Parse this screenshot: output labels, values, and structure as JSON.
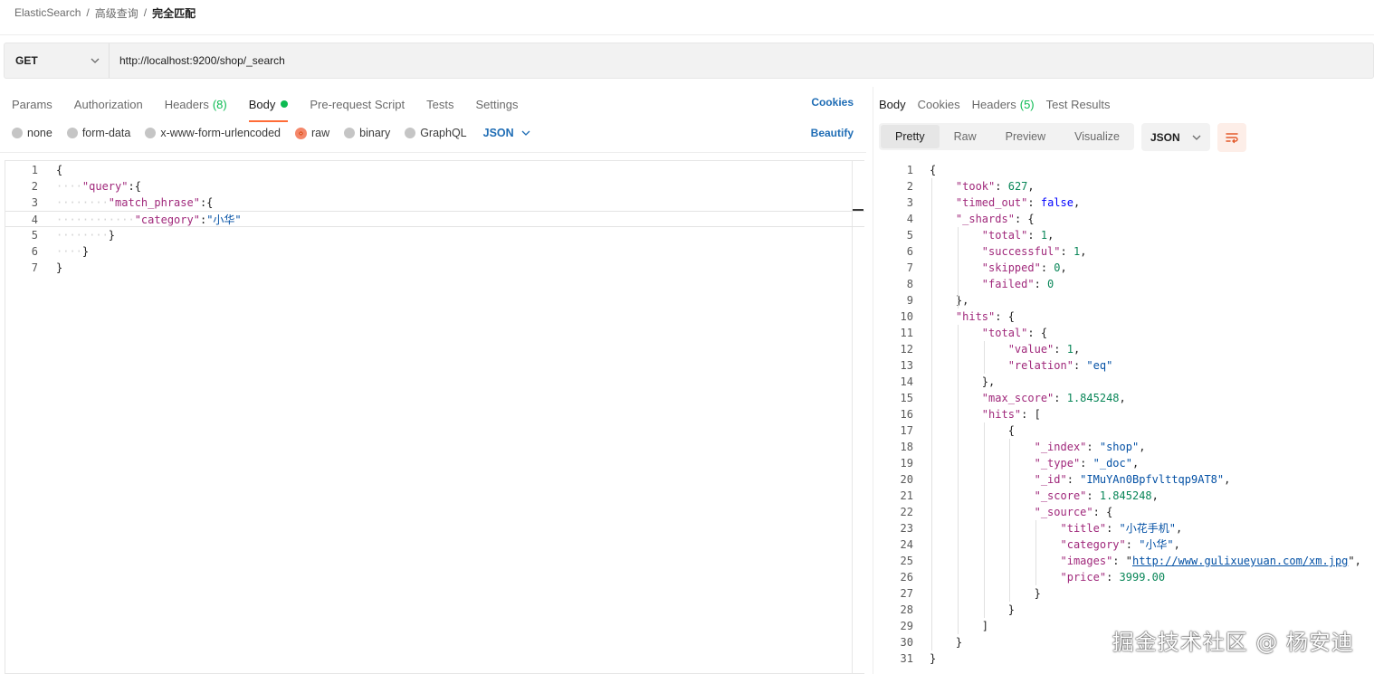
{
  "breadcrumb": {
    "root": "ElasticSearch",
    "mid": "高级查询",
    "current": "完全匹配",
    "sep": "/"
  },
  "request": {
    "method": "GET",
    "url": "http://localhost:9200/shop/_search"
  },
  "request_tabs": [
    {
      "label": "Params"
    },
    {
      "label": "Authorization"
    },
    {
      "label": "Headers",
      "count": "(8)"
    },
    {
      "label": "Body",
      "active": true
    },
    {
      "label": "Pre-request Script"
    },
    {
      "label": "Tests"
    },
    {
      "label": "Settings"
    }
  ],
  "cookies_label": "Cookies",
  "body_types": [
    {
      "label": "none"
    },
    {
      "label": "form-data"
    },
    {
      "label": "x-www-form-urlencoded"
    },
    {
      "label": "raw",
      "selected": true
    },
    {
      "label": "binary"
    },
    {
      "label": "GraphQL"
    }
  ],
  "body_format": "JSON",
  "beautify_label": "Beautify",
  "request_body_lines": [
    "{",
    "····\"query\":{",
    "········\"match_phrase\":{",
    "············\"category\":\"小华\"",
    "········}",
    "····}",
    "}"
  ],
  "response_tabs": [
    {
      "label": "Body",
      "active": true
    },
    {
      "label": "Cookies"
    },
    {
      "label": "Headers",
      "count": "(5)"
    },
    {
      "label": "Test Results"
    }
  ],
  "view_modes": [
    "Pretty",
    "Raw",
    "Preview",
    "Visualize"
  ],
  "response_format": "JSON",
  "response_lines": [
    "{",
    "    \"took\": 627,",
    "    \"timed_out\": false,",
    "    \"_shards\": {",
    "        \"total\": 1,",
    "        \"successful\": 1,",
    "        \"skipped\": 0,",
    "        \"failed\": 0",
    "    },",
    "    \"hits\": {",
    "        \"total\": {",
    "            \"value\": 1,",
    "            \"relation\": \"eq\"",
    "        },",
    "        \"max_score\": 1.845248,",
    "        \"hits\": [",
    "            {",
    "                \"_index\": \"shop\",",
    "                \"_type\": \"_doc\",",
    "                \"_id\": \"IMuYAn0Bpfvlttqp9AT8\",",
    "                \"_score\": 1.845248,",
    "                \"_source\": {",
    "                    \"title\": \"小花手机\",",
    "                    \"category\": \"小华\",",
    "                    \"images\": \"http://www.gulixueyuan.com/xm.jpg\",",
    "                    \"price\": 3999.00",
    "                }",
    "            }",
    "        ]",
    "    }",
    "}"
  ],
  "watermark": "掘金技术社区 @ 杨安迪"
}
